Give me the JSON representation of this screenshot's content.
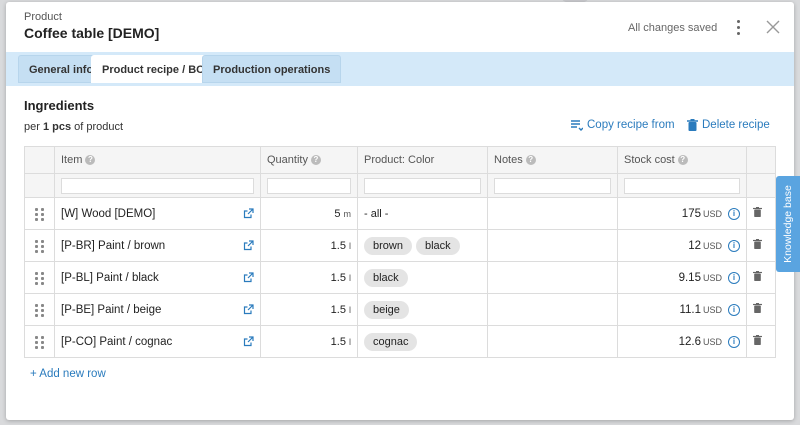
{
  "header": {
    "kicker": "Product",
    "title": "Coffee table [DEMO]",
    "status": "All changes saved"
  },
  "tabs": [
    {
      "label": "General info",
      "active": false
    },
    {
      "label": "Product recipe / BOM",
      "active": true
    },
    {
      "label": "Production operations",
      "active": false
    }
  ],
  "section": {
    "title": "Ingredients",
    "per_prefix": "per",
    "per_qty": "1 pcs",
    "per_suffix": "of product",
    "copy_label": "Copy recipe from",
    "delete_label": "Delete recipe"
  },
  "columns": [
    "Item",
    "Quantity",
    "Product: Color",
    "Notes",
    "Stock cost"
  ],
  "rows": [
    {
      "item": "[W] Wood [DEMO]",
      "qty": "5",
      "unit": "m",
      "colors": [],
      "any": "- all -",
      "notes": "",
      "cost": "175",
      "currency": "USD"
    },
    {
      "item": "[P-BR] Paint / brown",
      "qty": "1.5",
      "unit": "l",
      "colors": [
        "brown",
        "black"
      ],
      "any": "",
      "notes": "",
      "cost": "12",
      "currency": "USD"
    },
    {
      "item": "[P-BL] Paint / black",
      "qty": "1.5",
      "unit": "l",
      "colors": [
        "black"
      ],
      "any": "",
      "notes": "",
      "cost": "9.15",
      "currency": "USD"
    },
    {
      "item": "[P-BE] Paint / beige",
      "qty": "1.5",
      "unit": "l",
      "colors": [
        "beige"
      ],
      "any": "",
      "notes": "",
      "cost": "11.1",
      "currency": "USD"
    },
    {
      "item": "[P-CO] Paint / cognac",
      "qty": "1.5",
      "unit": "l",
      "colors": [
        "cognac"
      ],
      "any": "",
      "notes": "",
      "cost": "12.6",
      "currency": "USD"
    }
  ],
  "add_row_label": "+ Add new row",
  "knowledge_base_label": "Knowledge base",
  "colors": {
    "accent": "#2a7bbd",
    "tabbar": "#d4e9f9",
    "kb_button": "#5aa4e0"
  }
}
